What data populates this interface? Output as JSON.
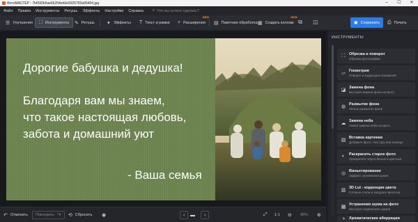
{
  "titlebar": {
    "title": "ФотоМАСТЕР - 7b65f2b5ae66254eb0e9926783a95404.jpg",
    "minimize": "–",
    "maximize": "☐",
    "close": "✕"
  },
  "menu": {
    "items": [
      "Файл",
      "Правка",
      "Инструменты",
      "Ретушь",
      "Эффекты",
      "Настройки",
      "Справка"
    ],
    "search_placeholder": "Что вы хотите сделать?"
  },
  "toolbar": {
    "enhance": "Улучшения",
    "tools": "Инструменты",
    "retouch": "Ретушь",
    "effects": "Эффекты",
    "text": "Текст и рамки",
    "extensions": "Расширения",
    "batch": "Пакетная обработка",
    "collage": "Создать коллаж",
    "new_badge": "NEW",
    "save": "Сохранить",
    "print": "Печать"
  },
  "canvas": {
    "line1": "Дорогие бабушка и дедушка!",
    "line2": "Благодаря вам мы знаем,",
    "line3": "что такое настоящая любовь,",
    "line4": "забота и домашний уют",
    "signature": "- Ваша семья",
    "panel_color": "#6e8650"
  },
  "bottombar": {
    "undo": "Отменить",
    "redo": "Повторить",
    "reset": "Сбросить",
    "ratio": "1:1",
    "zoom": "98%"
  },
  "panel": {
    "header": "ИНСТРУМЕНТЫ",
    "tools": [
      {
        "name": "Обрезка и поворот",
        "desc": "Обрезка фотографии",
        "icon": "crop-icon"
      },
      {
        "name": "Геометрия",
        "desc": "Поворот и коррекция искажений",
        "icon": "geometry-icon"
      },
      {
        "name": "Замена фона",
        "desc": "Быстрая замена фона на фото",
        "icon": "background-replace-icon"
      },
      {
        "name": "Размытие фона",
        "desc": "Лёгкое размытие фона",
        "icon": "blur-icon"
      },
      {
        "name": "Замена неба",
        "desc": "Умная замена неба на фото",
        "icon": "sky-icon"
      },
      {
        "name": "Вставка картинки",
        "desc": "Добавьте фото, текстуру или клипарт",
        "icon": "insert-image-icon"
      },
      {
        "name": "Раскрасить старое фото",
        "desc": "Превратите чёрно-белые в цветные",
        "icon": "colorize-icon"
      },
      {
        "name": "Виньетирование",
        "desc": "Эффект затемнения краев",
        "icon": "vignette-icon"
      },
      {
        "name": "3D Lut - коррекция цвета",
        "desc": "Готовые стили и загрузка пресетов",
        "icon": "lut-icon"
      },
      {
        "name": "Устранение шума на фото",
        "desc": "Быстрое подавление шумов",
        "icon": "denoise-icon"
      },
      {
        "name": "Хроматические аберрации",
        "desc": "",
        "icon": "chromatic-icon"
      }
    ]
  }
}
